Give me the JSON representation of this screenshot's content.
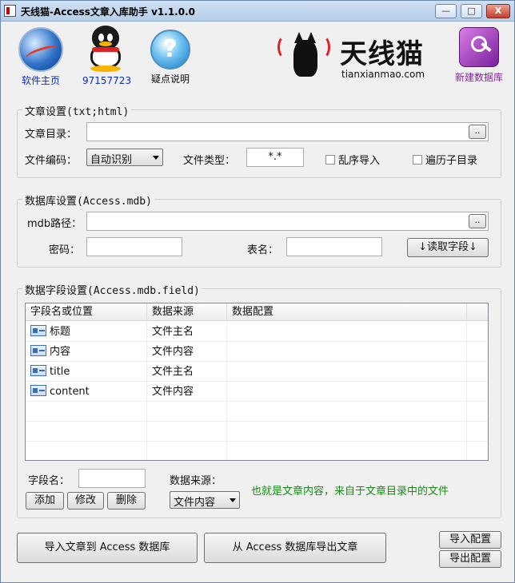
{
  "window": {
    "title": "天线猫-Access文章入库助手 v1.1.0.0",
    "controls": {
      "minimize": "—",
      "maximize": "□",
      "close": "X"
    }
  },
  "toolbar": {
    "homepage_label": "软件主页",
    "qq_label": "97157723",
    "help_label": "疑点说明",
    "brand_name": "天线猫",
    "brand_domain": "tianxianmao.com",
    "newdb_label": "新建数据库",
    "help_glyph": "?"
  },
  "article_settings": {
    "title": "文章设置(txt;html)",
    "dir_label": "文章目录：",
    "dir_value": "",
    "browse_label": "..",
    "encoding_label": "文件编码：",
    "encoding_value": "自动识别",
    "filetype_label": "文件类型：",
    "filetype_value": "*.*",
    "shuffle_label": "乱序导入",
    "subdir_label": "遍历子目录"
  },
  "db_settings": {
    "title": "数据库设置(Access.mdb)",
    "path_label": "mdb路径：",
    "path_value": "",
    "browse_label": "..",
    "password_label": "密码：",
    "password_value": "",
    "table_label": "表名：",
    "table_value": "",
    "read_fields_label": "↓读取字段↓"
  },
  "field_settings": {
    "title": "数据字段设置(Access.mdb.field)",
    "columns": [
      "字段名或位置",
      "数据来源",
      "数据配置"
    ],
    "rows": [
      {
        "name": "标题",
        "source": "文件主名",
        "config": ""
      },
      {
        "name": "内容",
        "source": "文件内容",
        "config": ""
      },
      {
        "name": "title",
        "source": "文件主名",
        "config": ""
      },
      {
        "name": "content",
        "source": "文件内容",
        "config": ""
      }
    ],
    "field_name_label": "字段名：",
    "field_name_value": "",
    "add_label": "添加",
    "edit_label": "修改",
    "delete_label": "删除",
    "source_label": "数据来源：",
    "source_value": "文件内容",
    "hint": "也就是文章内容，来自于文章目录中的文件"
  },
  "actions": {
    "import_label": "导入文章到 Access 数据库",
    "export_label": "从 Access 数据库导出文章",
    "import_config_label": "导入配置",
    "export_config_label": "导出配置"
  },
  "colors": {
    "link_blue": "#0a2bbb",
    "hint_green": "#1a8a1a",
    "brand_red": "#e02222",
    "newdb_purple": "#8a1faa"
  }
}
